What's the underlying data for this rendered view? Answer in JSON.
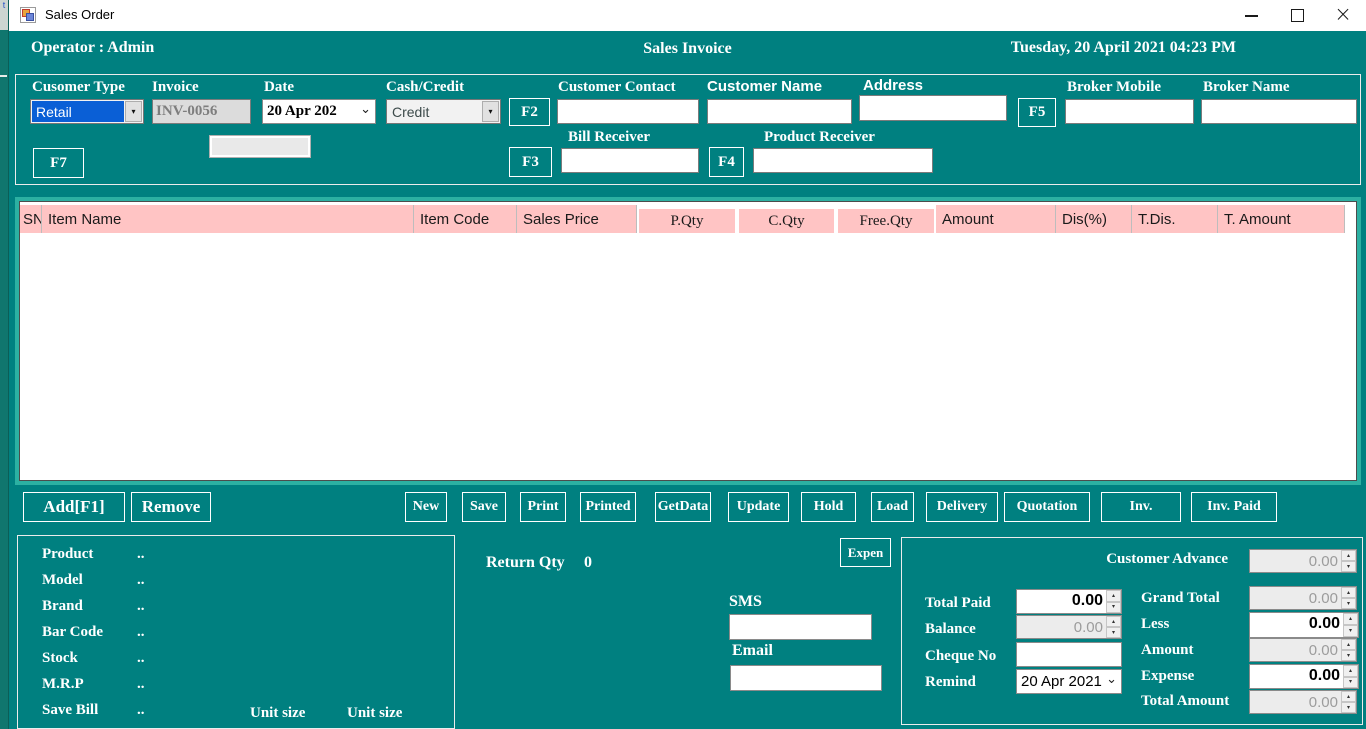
{
  "desktop": {
    "edge_text": "t"
  },
  "window": {
    "title": "Sales Order"
  },
  "icons": {
    "minimize": "css-shape",
    "maximize": "css-shape",
    "close": "×",
    "combo_arrow": "▾",
    "chevron_down": "⌄",
    "spin_up": "▴",
    "spin_down": "▾"
  },
  "header": {
    "operator": "Operator : Admin",
    "title": "Sales Invoice",
    "datetime": "Tuesday, 20 April 2021 04:23 PM"
  },
  "form": {
    "customer_type": {
      "label": "Cusomer Type",
      "value": "Retail"
    },
    "invoice": {
      "label": "Invoice",
      "value": "INV-0056"
    },
    "date": {
      "label": "Date",
      "value": "20 Apr 202"
    },
    "cash_credit": {
      "label": "Cash/Credit",
      "value": "Credit"
    },
    "customer_contact": {
      "label": "Customer Contact",
      "value": ""
    },
    "customer_name": {
      "label": "Customer Name",
      "value": ""
    },
    "address": {
      "label": "Address",
      "value": ""
    },
    "broker_mobile": {
      "label": "Broker Mobile",
      "value": ""
    },
    "broker_name": {
      "label": "Broker Name",
      "value": ""
    },
    "bill_receiver": {
      "label": "Bill Receiver",
      "value": ""
    },
    "product_receiver": {
      "label": "Product Receiver",
      "value": ""
    },
    "f2": "F2",
    "f3": "F3",
    "f4": "F4",
    "f5": "F5",
    "f7": "F7",
    "row2_box_value": ""
  },
  "table": {
    "columns": [
      "SN",
      "Item Name",
      "Item Code",
      "Sales Price",
      "P.Qty",
      "C.Qty",
      "Free.Qty",
      "Amount",
      "Dis(%)",
      "T.Dis.",
      "T. Amount"
    ],
    "rows": []
  },
  "actions": {
    "add": "Add[F1]",
    "remove": "Remove",
    "buttons": [
      "New",
      "Save",
      "Print",
      "Printed",
      "GetData",
      "Update",
      "Hold",
      "Load",
      "Delivery",
      "Quotation",
      "Inv.",
      "Inv. Paid"
    ]
  },
  "details": {
    "rows": [
      {
        "label": "Product",
        "value": ".."
      },
      {
        "label": "Model",
        "value": ".."
      },
      {
        "label": "Brand",
        "value": ".."
      },
      {
        "label": "Bar Code",
        "value": ".."
      },
      {
        "label": "Stock",
        "value": ".."
      },
      {
        "label": "M.R.P",
        "value": ".."
      },
      {
        "label": "Save Bill",
        "value": ".."
      }
    ],
    "unit_size_1": "Unit size",
    "unit_size_2": "Unit size"
  },
  "middle": {
    "return_qty_label": "Return Qty",
    "return_qty_value": "0",
    "expen_button": "Expen",
    "sms": {
      "label": "SMS",
      "value": ""
    },
    "email": {
      "label": "Email",
      "value": ""
    }
  },
  "payments": {
    "customer_advance": {
      "label": "Customer Advance",
      "value": "0.00"
    },
    "total_paid": {
      "label": "Total Paid",
      "value": "0.00"
    },
    "balance": {
      "label": "Balance",
      "value": "0.00"
    },
    "cheque_no": {
      "label": "Cheque No",
      "value": ""
    },
    "remind": {
      "label": "Remind",
      "value": "20 Apr 2021"
    },
    "grand_total": {
      "label": "Grand Total",
      "value": "0.00"
    },
    "less": {
      "label": "Less",
      "value": "0.00"
    },
    "amount": {
      "label": "Amount",
      "value": "0.00"
    },
    "expense": {
      "label": "Expense",
      "value": "0.00"
    },
    "total_amount": {
      "label": "Total Amount",
      "value": "0.00"
    }
  },
  "colors": {
    "teal_background": "#008080",
    "table_header_pink": "#ffc4c4",
    "table_frame_green": "#2cb0a2",
    "selection_blue": "#0a5fd6",
    "titlebar_white": "#ffffff"
  }
}
